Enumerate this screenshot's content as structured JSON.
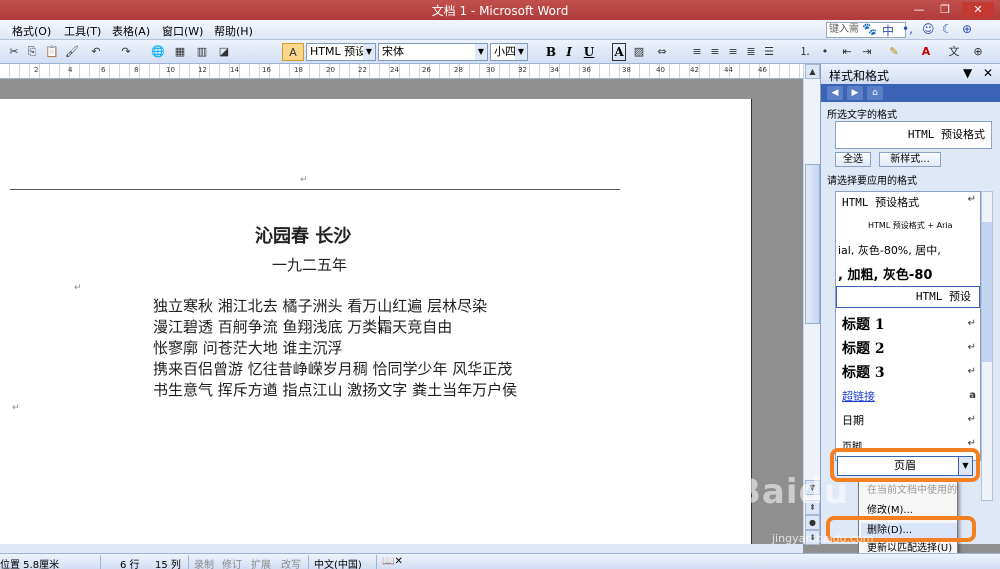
{
  "window": {
    "title": "文档 1 - Microsoft Word",
    "minimize": "—",
    "restore": "❐",
    "close": "✕"
  },
  "menubar": {
    "items": [
      "格式(O)",
      "工具(T)",
      "表格(A)",
      "窗口(W)",
      "帮助(H)"
    ],
    "help_placeholder": "键入需",
    "ime": [
      "中",
      "•,",
      "☺",
      "☾",
      "⊕"
    ]
  },
  "toolbar": {
    "style_value": "HTML 预设",
    "font_value": "宋体",
    "size_value": "小四",
    "bold": "B",
    "italic": "I",
    "underline": "U",
    "char_border": "A"
  },
  "ruler": {
    "numbers": [
      "2",
      "4",
      "6",
      "8",
      "10",
      "12",
      "14",
      "16",
      "18",
      "20",
      "22",
      "24",
      "26",
      "28",
      "30",
      "32",
      "34",
      "36",
      "38",
      "40",
      "42",
      "44",
      "46"
    ]
  },
  "document": {
    "title": "沁园春  长沙",
    "date": "一九二五年",
    "lines": [
      "独立寒秋  湘江北去  橘子洲头  看万山红遍  层林尽染",
      "漫江碧透  百舸争流  鱼翔浅底  万类霜天竞自由",
      "怅寥廓  问苍茫大地  谁主沉浮",
      "携来百侣曾游  忆往昔峥嵘岁月稠  恰同学少年  风华正茂",
      "书生意气  挥斥方遒  指点江山  激扬文字  粪土当年万户侯"
    ],
    "para_mark": "↵"
  },
  "taskpane": {
    "title": "样式和格式",
    "selected_text_label": "所选文字的格式",
    "selected_format": "HTML 预设格式",
    "select_all_button": "全选",
    "new_style_button": "新样式...",
    "apply_label": "请选择要应用的格式",
    "styles": [
      "HTML 预设格式",
      "HTML 预设格式 + Aria",
      "ial, 灰色-80%, 居中,",
      ", 加粗, 灰色-80",
      "HTML 预设",
      "标题 1",
      "标题 2",
      "标题 3",
      "超链接",
      "日期",
      "页脚"
    ],
    "dropdown_value": "页眉"
  },
  "context_menu": {
    "items": [
      "在当前文档中使用的",
      "修改(M)...",
      "删除(D)...",
      "更新以匹配选择(U)"
    ]
  },
  "statusbar": {
    "position": "位置 5.8厘米",
    "line": "6 行",
    "col": "15 列",
    "rec": "录制",
    "trk": "修订",
    "ext": "扩展",
    "ovr": "改写",
    "lang": "中文(中国)"
  },
  "watermark": {
    "logo": "Baidu",
    "site": "jingyan.baidu.com"
  },
  "colors": {
    "titlebar": "#c0504d",
    "highlight": "#f47f20",
    "pane": "#dfe8f6"
  }
}
